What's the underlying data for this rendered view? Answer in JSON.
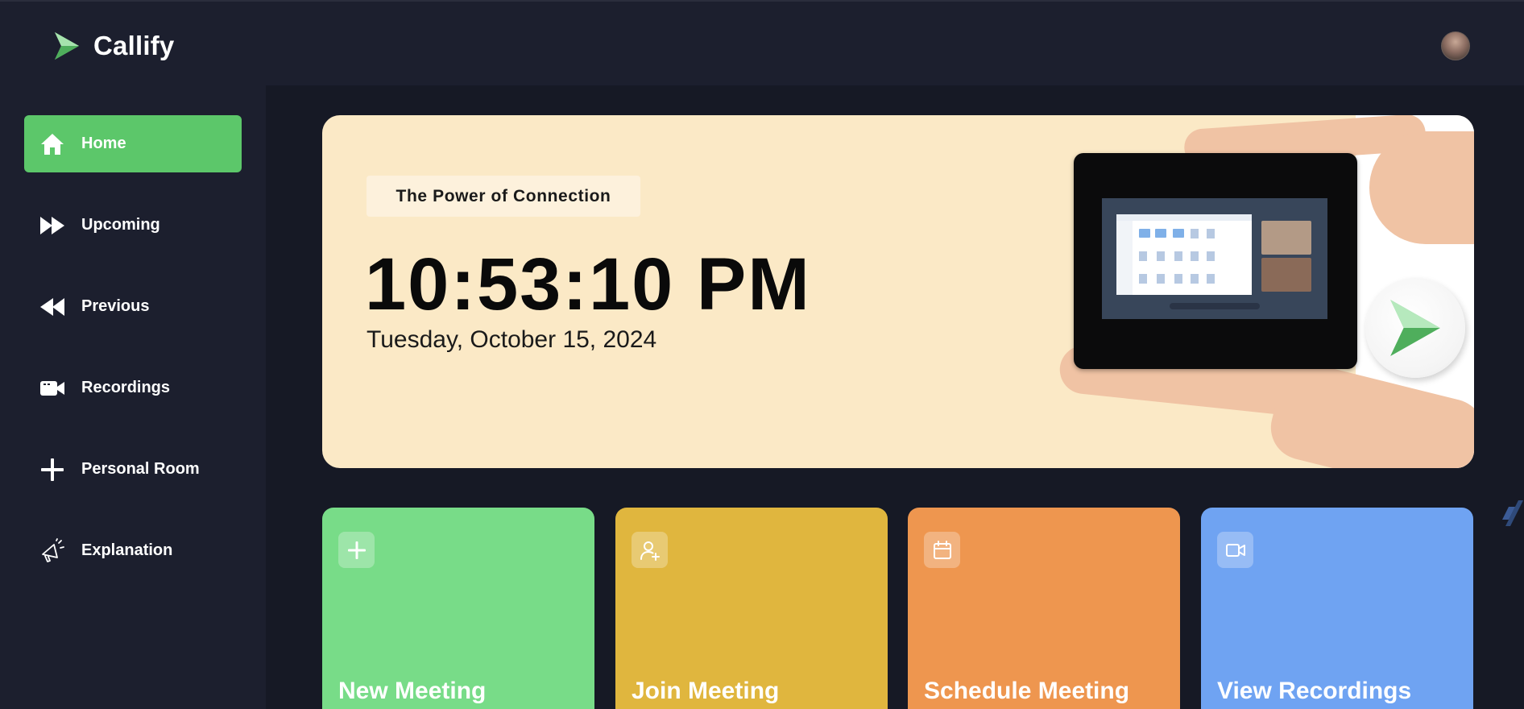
{
  "app": {
    "name": "Callify",
    "brand_color": "#5cc76a",
    "brand_icon": "play-triangle-icon"
  },
  "header": {
    "avatar": "user-avatar"
  },
  "sidebar": {
    "items": [
      {
        "label": "Home",
        "icon": "home-icon",
        "active": true
      },
      {
        "label": "Upcoming",
        "icon": "fast-forward-icon",
        "active": false
      },
      {
        "label": "Previous",
        "icon": "rewind-icon",
        "active": false
      },
      {
        "label": "Recordings",
        "icon": "video-camera-icon",
        "active": false
      },
      {
        "label": "Personal Room",
        "icon": "plus-icon",
        "active": false
      },
      {
        "label": "Explanation",
        "icon": "megaphone-icon",
        "active": false
      }
    ],
    "active_color": "#5cc76a"
  },
  "hero": {
    "badge": "The Power of Connection",
    "time": "10:53:10 PM",
    "date": "Tuesday, October 15, 2024",
    "background": "#fbe9c6"
  },
  "cards": [
    {
      "title": "New Meeting",
      "icon": "plus-icon",
      "color": "#78dc88"
    },
    {
      "title": "Join Meeting",
      "icon": "user-plus-icon",
      "color": "#e0b63e"
    },
    {
      "title": "Schedule Meeting",
      "icon": "calendar-icon",
      "color": "#ee964f"
    },
    {
      "title": "View Recordings",
      "icon": "video-icon",
      "color": "#6fa3f2"
    }
  ]
}
